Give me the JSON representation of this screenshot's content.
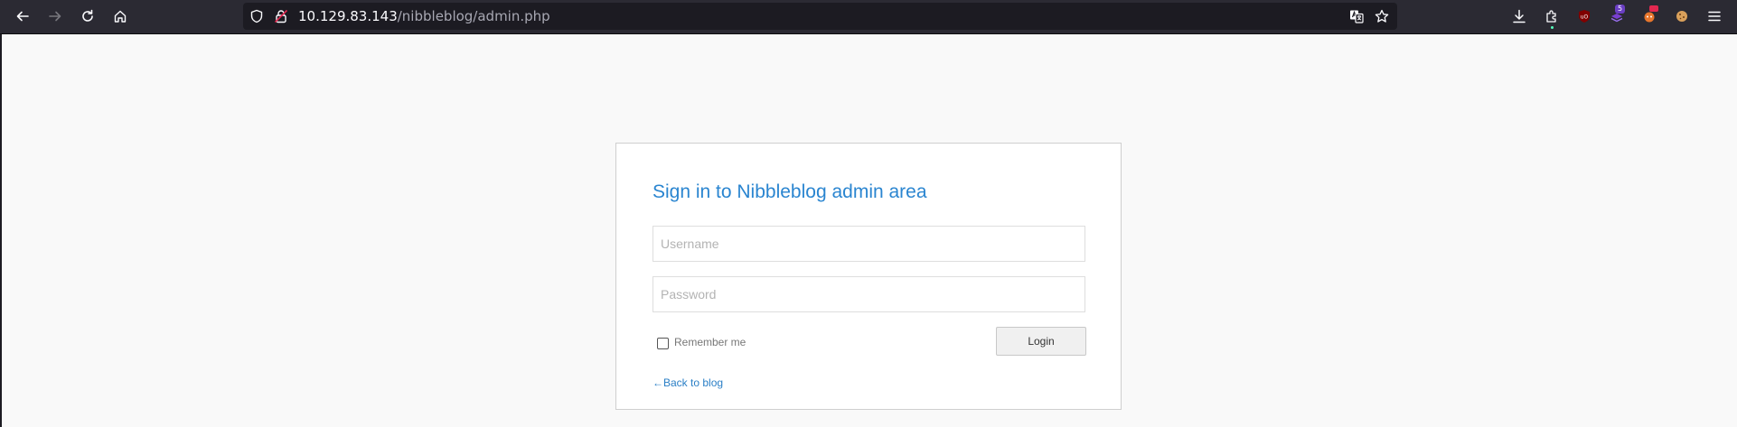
{
  "browser": {
    "url_host": "10.129.83.143",
    "url_path": "/nibbleblog/admin.php",
    "extension_badges": {
      "purple": "5"
    }
  },
  "login": {
    "title": "Sign in to Nibbleblog admin area",
    "username_placeholder": "Username",
    "password_placeholder": "Password",
    "remember_label": "Remember me",
    "login_button": "Login",
    "back_arrow": "←",
    "back_link": "Back to blog"
  },
  "colors": {
    "title": "#2a85d0",
    "link": "#2a7fc6",
    "toolbar_bg": "#2b2a33",
    "urlbar_bg": "#1c1b22",
    "page_bg": "#f9f9f9"
  }
}
